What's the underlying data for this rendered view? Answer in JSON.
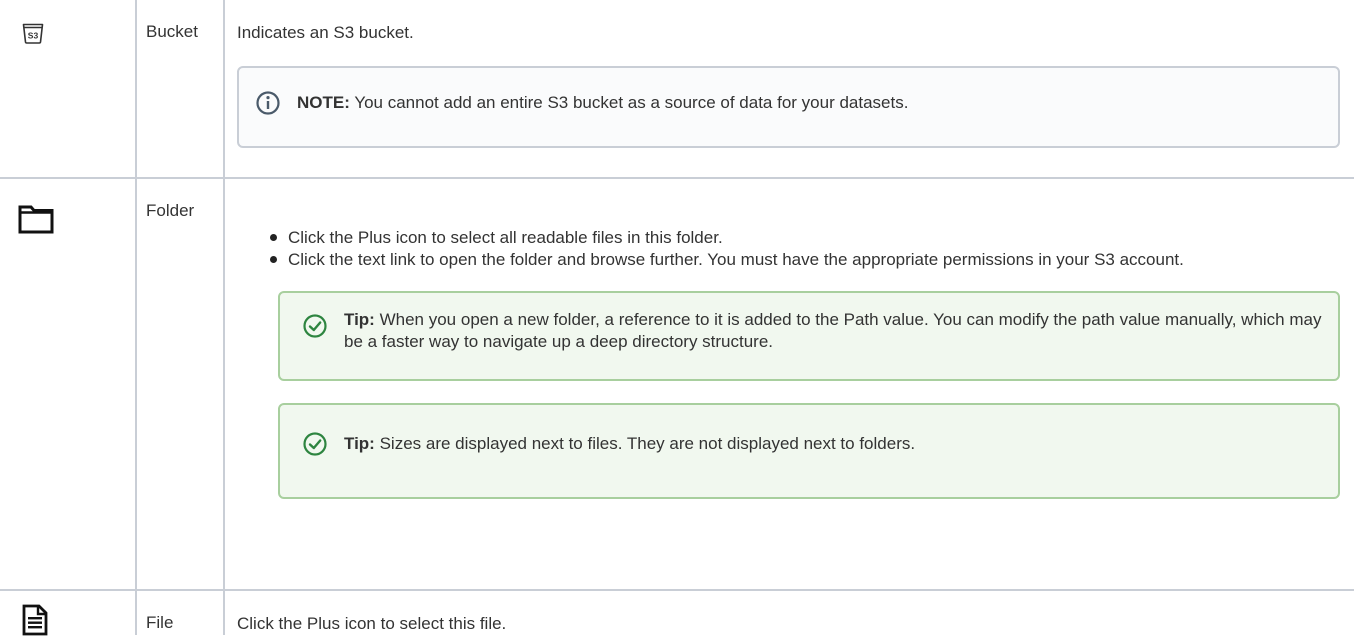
{
  "rows": [
    {
      "icon": "s3-bucket-icon",
      "type": "Bucket",
      "description": "Indicates an S3 bucket.",
      "note": {
        "label": "NOTE:",
        "text": "You cannot add an entire S3 bucket as a source of data for your datasets."
      }
    },
    {
      "icon": "folder-icon",
      "type": "Folder",
      "bullets": [
        "Click the Plus icon to select all readable files in this folder.",
        "Click the text link to open the folder and browse further. You must have the appropriate permissions in your S3 account."
      ],
      "tips": [
        {
          "label": "Tip:",
          "text": "When you open a new folder, a reference to it is added to the Path value. You can modify the path value manually, which may be a faster way to navigate up a deep directory structure."
        },
        {
          "label": "Tip:",
          "text": "Sizes are displayed next to files. They are not displayed next to folders."
        }
      ]
    },
    {
      "icon": "file-document-icon",
      "type": "File",
      "description": "Click the Plus icon to select this file."
    }
  ],
  "colors": {
    "border": "#c9ced6",
    "note_bg": "#fafbfc",
    "note_icon": "#4a5a6a",
    "tip_border": "#a8cf9e",
    "tip_bg": "#f1f8ef",
    "tip_icon": "#2e8540"
  }
}
